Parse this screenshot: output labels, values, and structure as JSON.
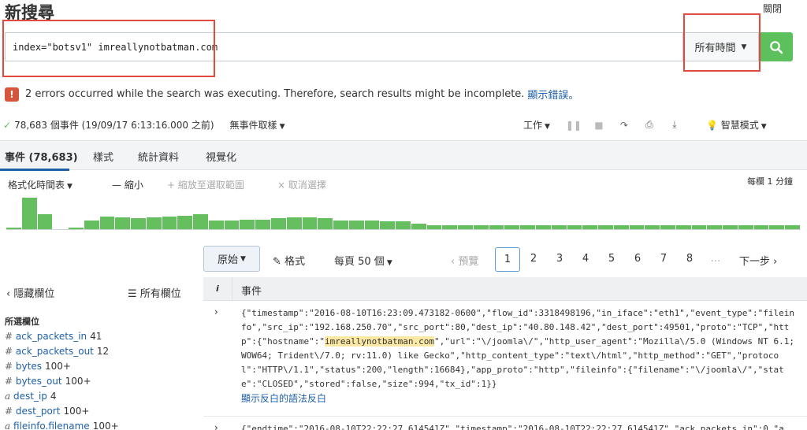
{
  "header": {
    "title": "新搜尋",
    "close_label": "關閉"
  },
  "search": {
    "query": "index=\"botsv1\" imreallynotbatman.com",
    "time_range": "所有時間",
    "search_icon": "search-icon"
  },
  "error": {
    "icon": "!",
    "message": "2 errors occurred while the search was executing. Therefore, search results might be incomplete.",
    "link": "顯示錯誤。"
  },
  "status": {
    "summary": "78,683 個事件 (19/09/17 6:13:16.000 之前)",
    "sampling": "無事件取樣"
  },
  "toolbar": {
    "job": "工作",
    "smart_mode": "智慧模式"
  },
  "tabs": [
    "事件 (78,683)",
    "樣式",
    "統計資料",
    "視覺化"
  ],
  "timeline": {
    "format": "格式化時間表",
    "zoom_out": "— 縮小",
    "zoom_to_sel": "+ 縮放至選取範圍",
    "deselect": "× 取消選擇",
    "per_column": "每欄 1 分鐘"
  },
  "histogram": {
    "color": "#65bf5f",
    "values": [
      2,
      32,
      15,
      0,
      2,
      9,
      13,
      12,
      11,
      12,
      13,
      14,
      15,
      9,
      9,
      10,
      10,
      11,
      12,
      12,
      11,
      9,
      9,
      9,
      8,
      8,
      6,
      4,
      4,
      4,
      4,
      4,
      4,
      4,
      4,
      4,
      4,
      4,
      4,
      4,
      4,
      4,
      4,
      4,
      4,
      4,
      4,
      4,
      4,
      4,
      4
    ]
  },
  "pager": {
    "view_mode": "原始",
    "format": "格式",
    "per_page": "每頁 50 個",
    "prev": "‹ 預覽",
    "pages": [
      "1",
      "2",
      "3",
      "4",
      "5",
      "6",
      "7",
      "8",
      "..."
    ],
    "next": "下一步 ›"
  },
  "sidebar": {
    "hide_fields": "‹ 隱藏欄位",
    "all_fields": "所有欄位",
    "selected_label": "所選欄位",
    "fields": [
      {
        "type": "#",
        "name": "ack_packets_in",
        "count": "41"
      },
      {
        "type": "#",
        "name": "ack_packets_out",
        "count": "12"
      },
      {
        "type": "#",
        "name": "bytes",
        "count": "100+"
      },
      {
        "type": "#",
        "name": "bytes_out",
        "count": "100+"
      },
      {
        "type": "a",
        "name": "dest_ip",
        "count": "4"
      },
      {
        "type": "#",
        "name": "dest_port",
        "count": "100+"
      },
      {
        "type": "a",
        "name": "fileinfo.filename",
        "count": "100+"
      }
    ]
  },
  "events_table": {
    "col_i": "i",
    "col_event": "事件",
    "rows": [
      {
        "pre": "{\"timestamp\":\"2016-08-10T16:23:09.473182-0600\",\"flow_id\":3318498196,\"in_iface\":\"eth1\",\"event_type\":\"fileinfo\",\"src_ip\":\"192.168.250.70\",\"src_port\":80,\"dest_ip\":\"40.80.148.42\",\"dest_port\":49501,\"proto\":\"TCP\",\"http\":{\"hostname\":\"",
        "highlight": "imreallynotbatman.com",
        "post": "\",\"url\":\"\\/joomla\\/\",\"http_user_agent\":\"Mozilla\\/5.0 (Windows NT 6.1; WOW64; Trident\\/7.0; rv:11.0) like Gecko\",\"http_content_type\":\"text\\/html\",\"http_method\":\"GET\",\"protocol\":\"HTTP\\/1.1\",\"status\":200,\"length\":16684},\"app_proto\":\"http\",\"fileinfo\":{\"filename\":\"\\/joomla\\/\",\"state\":\"CLOSED\",\"stored\":false,\"size\":994,\"tx_id\":1}}",
        "link": "顯示反白的語法反白"
      },
      {
        "pre": "{\"endtime\":\"2016-08-10T22:22:27.614541Z\",\"timestamp\":\"2016-08-10T22:22:27.614541Z\",\"ack_packets_in\":0,\"a",
        "highlight": "",
        "post": "",
        "link": ""
      }
    ]
  }
}
